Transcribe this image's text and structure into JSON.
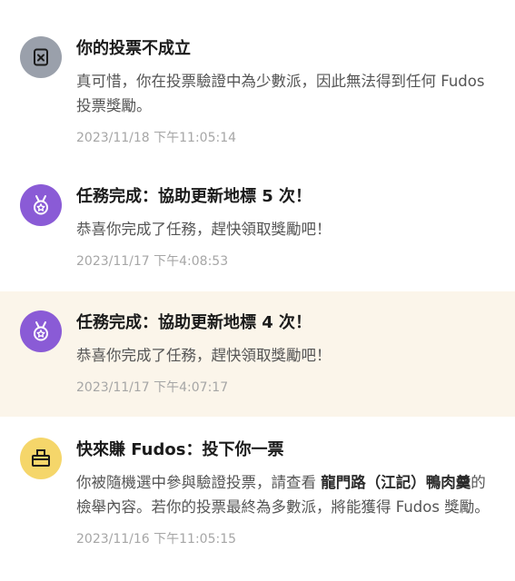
{
  "notifications": [
    {
      "icon": "ballot-x-icon",
      "icon_color": "#9aa0ab",
      "title": "你的投票不成立",
      "desc": "真可惜，你在投票驗證中為少數派，因此無法得到任何 Fudos 投票獎勵。",
      "time": "2023/11/18 下午11:05:14"
    },
    {
      "icon": "medal-icon",
      "icon_color": "#8a5bd6",
      "title": "任務完成：協助更新地標 5 次！",
      "desc": "恭喜你完成了任務，趕快領取獎勵吧！",
      "time": "2023/11/17 下午4:08:53"
    },
    {
      "icon": "medal-icon",
      "icon_color": "#8a5bd6",
      "title": "任務完成：協助更新地標 4 次！",
      "desc": "恭喜你完成了任務，趕快領取獎勵吧！",
      "time": "2023/11/17 下午4:07:17",
      "highlight_bg": "#fbf5ea"
    },
    {
      "icon": "ballot-box-icon",
      "icon_color": "#f5d66a",
      "title": "快來賺 Fudos：投下你一票",
      "desc_pre": "你被隨機選中參與驗證投票，請查看 ",
      "desc_bold": "龍門路（江記）鴨肉羹",
      "desc_post": "的檢舉內容。若你的投票最終為多數派，將能獲得 Fudos 獎勵。",
      "time": "2023/11/16 下午11:05:15"
    }
  ]
}
